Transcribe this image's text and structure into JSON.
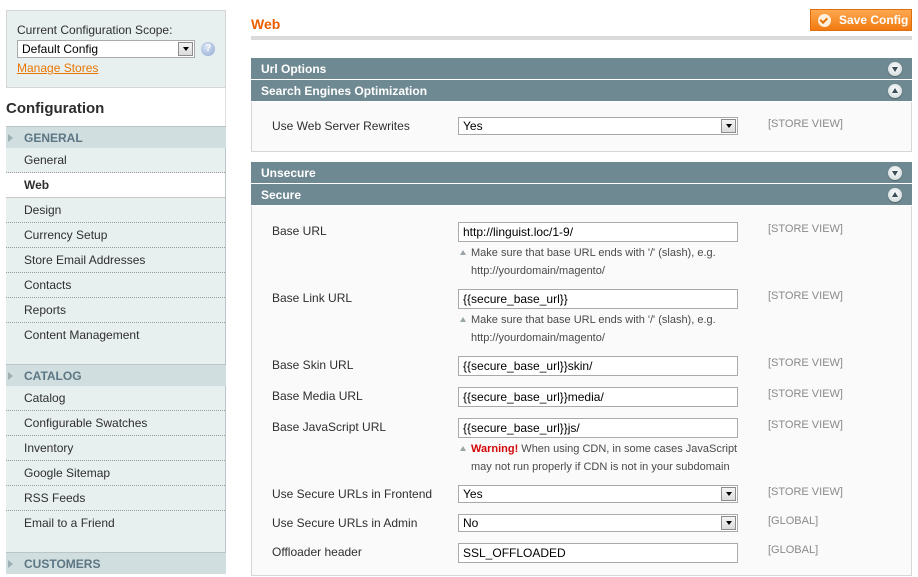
{
  "sidebar": {
    "scope_label": "Current Configuration Scope:",
    "scope_value": "Default Config",
    "manage_stores": "Manage Stores",
    "config_title": "Configuration",
    "sections": [
      {
        "title": "GENERAL",
        "items": [
          "General",
          "Web",
          "Design",
          "Currency Setup",
          "Store Email Addresses",
          "Contacts",
          "Reports",
          "Content Management"
        ],
        "active": "Web"
      },
      {
        "title": "CATALOG",
        "items": [
          "Catalog",
          "Configurable Swatches",
          "Inventory",
          "Google Sitemap",
          "RSS Feeds",
          "Email to a Friend"
        ]
      },
      {
        "title": "CUSTOMERS",
        "items": []
      }
    ]
  },
  "main": {
    "title": "Web",
    "save_label": "Save Config",
    "groups": {
      "url_options": "Url Options",
      "seo": "Search Engines Optimization",
      "unsecure": "Unsecure",
      "secure": "Secure"
    },
    "seo_fields": {
      "rewrites": {
        "label": "Use Web Server Rewrites",
        "value": "Yes",
        "scope": "[STORE VIEW]"
      }
    },
    "secure_fields": {
      "base_url": {
        "label": "Base URL",
        "value": "http://linguist.loc/1-9/",
        "scope": "[STORE VIEW]",
        "note_line1": "Make sure that base URL ends with '/' (slash), e.g.",
        "note_line2": "http://yourdomain/magento/"
      },
      "base_link_url": {
        "label": "Base Link URL",
        "value": "{{secure_base_url}}",
        "scope": "[STORE VIEW]",
        "note_line1": "Make sure that base URL ends with '/' (slash), e.g.",
        "note_line2": "http://yourdomain/magento/"
      },
      "base_skin_url": {
        "label": "Base Skin URL",
        "value": "{{secure_base_url}}skin/",
        "scope": "[STORE VIEW]"
      },
      "base_media_url": {
        "label": "Base Media URL",
        "value": "{{secure_base_url}}media/",
        "scope": "[STORE VIEW]"
      },
      "base_js_url": {
        "label": "Base JavaScript URL",
        "value": "{{secure_base_url}}js/",
        "scope": "[STORE VIEW]",
        "warning": "Warning!",
        "note_line1": " When using CDN, in some cases JavaScript",
        "note_line2": "may not run properly if CDN is not in your subdomain"
      },
      "use_frontend": {
        "label": "Use Secure URLs in Frontend",
        "value": "Yes",
        "scope": "[STORE VIEW]"
      },
      "use_admin": {
        "label": "Use Secure URLs in Admin",
        "value": "No",
        "scope": "[GLOBAL]"
      },
      "offloader": {
        "label": "Offloader header",
        "value": "SSL_OFFLOADED",
        "scope": "[GLOBAL]"
      }
    }
  },
  "colors": {
    "accent": "#eb5e00",
    "button_orange": "#f17a10",
    "group_header": "#6f8992",
    "sidebar_bg": "#e7efef",
    "section_head_text": "#5c7683",
    "warning": "#d40707"
  }
}
